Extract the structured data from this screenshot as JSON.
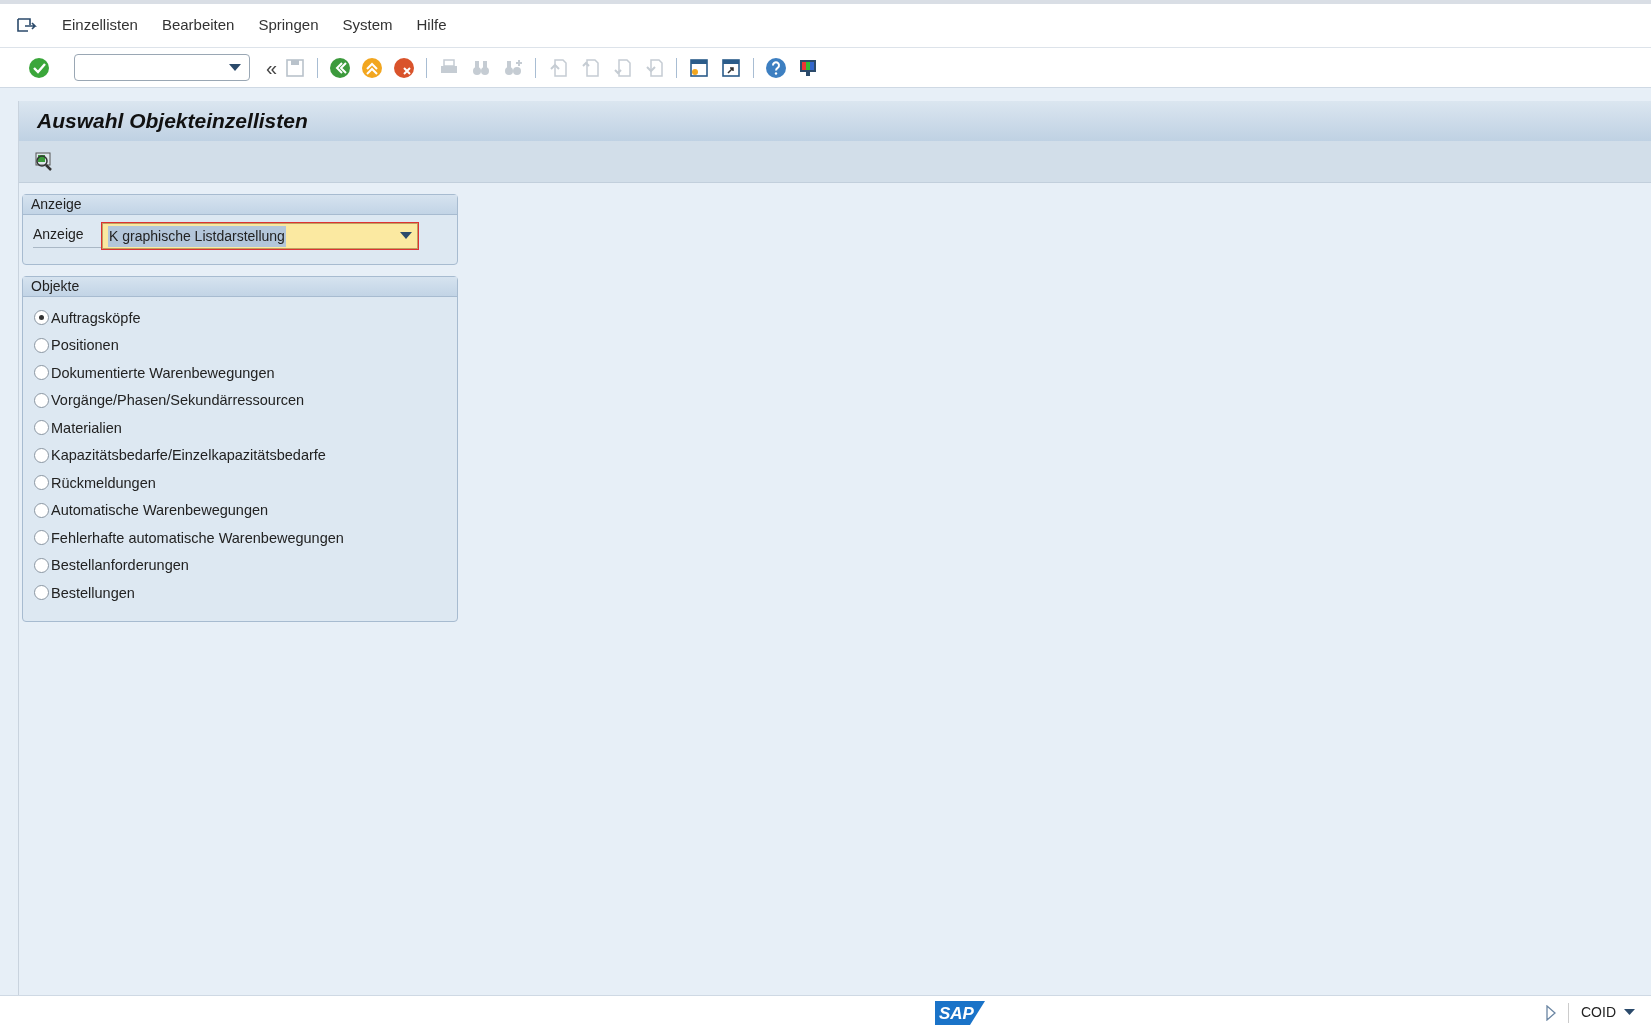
{
  "menu": [
    {
      "label": "Einzellisten"
    },
    {
      "label": "Bearbeiten"
    },
    {
      "label": "Springen"
    },
    {
      "label": "System"
    },
    {
      "label": "Hilfe"
    }
  ],
  "toolbar": {
    "back_glyph": "«"
  },
  "title": "Auswahl Objekteinzellisten",
  "display_group": {
    "title": "Anzeige",
    "label": "Anzeige",
    "value": "K graphische Listdarstellung"
  },
  "objects_group": {
    "title": "Objekte",
    "options": [
      {
        "label": "Auftragsköpfe",
        "selected": true
      },
      {
        "label": "Positionen",
        "selected": false
      },
      {
        "label": "Dokumentierte Warenbewegungen",
        "selected": false
      },
      {
        "label": "Vorgänge/Phasen/Sekundärressourcen",
        "selected": false
      },
      {
        "label": "Materialien",
        "selected": false
      },
      {
        "label": "Kapazitätsbedarfe/Einzelkapazitätsbedarfe",
        "selected": false
      },
      {
        "label": "Rückmeldungen",
        "selected": false
      },
      {
        "label": "Automatische Warenbewegungen",
        "selected": false
      },
      {
        "label": "Fehlerhafte automatische Warenbewegungen",
        "selected": false
      },
      {
        "label": "Bestellanforderungen",
        "selected": false
      },
      {
        "label": "Bestellungen",
        "selected": false
      }
    ]
  },
  "status_bar": {
    "logo": "SAP",
    "system": "COID"
  }
}
